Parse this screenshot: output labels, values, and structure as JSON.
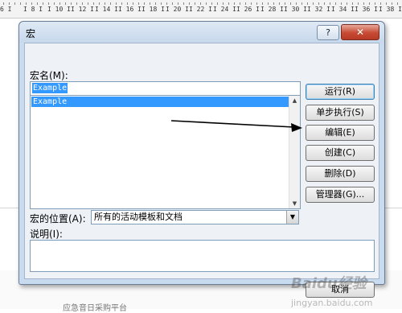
{
  "ruler": {
    "ticks": [
      "6 I",
      "I 8 I",
      "I 10 I",
      "I 12 I",
      "I 14 I",
      "I 16 I",
      "I 18 I",
      "I 20 I",
      "I 22 I",
      "I 24 I",
      "I 26 I",
      "I 28 I",
      "I 30 I",
      "I 32 I",
      "I 34 I",
      "I 36 I",
      "I 38 I"
    ]
  },
  "dialog": {
    "title": "宏",
    "help_label": "?",
    "close_label": "✕",
    "macro_name_label": "宏名(M):",
    "macro_name_value": "Example",
    "macro_list": [
      "Example"
    ],
    "buttons": {
      "run": "运行(R)",
      "step": "单步执行(S)",
      "edit": "编辑(E)",
      "create": "创建(C)",
      "delete": "删除(D)",
      "organizer": "管理器(G)...",
      "cancel": "取消"
    },
    "location_label": "宏的位置(A):",
    "location_value": "所有的活动模板和文档",
    "description_label": "说明(I):",
    "description_value": ""
  },
  "background": {
    "partial_text": "应急音日采购平台",
    "watermark": "Baidu经验",
    "watermark_sub": "jingyan.baidu.com"
  }
}
